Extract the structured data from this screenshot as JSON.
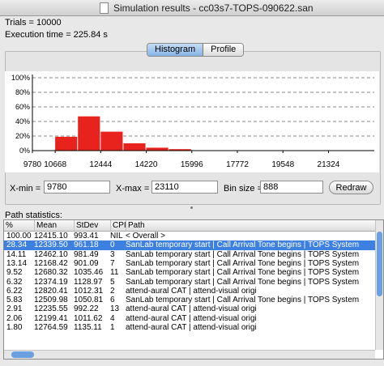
{
  "window": {
    "title": "Simulation results - cc03s7-TOPS-090622.san"
  },
  "summary": {
    "trials": "Trials = 10000",
    "execution_time": "Execution time = 225.84 s"
  },
  "tabs": [
    {
      "label": "Histogram",
      "active": true
    },
    {
      "label": "Profile",
      "active": false
    }
  ],
  "chart_data": {
    "type": "bar",
    "bar_color": "#e8231d",
    "x": [
      9780,
      10668,
      11556,
      12444,
      13332,
      14220,
      15108,
      15996,
      16884,
      17772,
      18660,
      19548,
      20436,
      21324,
      22212
    ],
    "values": [
      0.5,
      19,
      47,
      26,
      10,
      4,
      2,
      0.5,
      0,
      0,
      0,
      0,
      0,
      0,
      0
    ],
    "bin_size": 888,
    "xlim": [
      9780,
      23110
    ],
    "ylim": [
      0,
      100
    ],
    "y_ticks": [
      "0%",
      "20%",
      "40%",
      "60%",
      "80%",
      "100%"
    ],
    "x_ticks": [
      9780,
      10668,
      12444,
      14220,
      15996,
      17772,
      19548,
      21324
    ],
    "grid": true
  },
  "controls": {
    "xmin_label": "X-min =",
    "xmin_value": "9780",
    "xmax_label": "X-max =",
    "xmax_value": "23110",
    "binsize_label": "Bin size =",
    "binsize_value": "888",
    "redraw_label": "Redraw"
  },
  "path_stats": {
    "label": "Path statistics:",
    "columns": [
      "%",
      "Mean",
      "StDev",
      "CPI",
      "Path"
    ],
    "rows": [
      [
        "100.00",
        "12415.10",
        "993.41",
        "NIL",
        "< Overall >"
      ],
      [
        "28.34",
        "12339.50",
        "961.18",
        "0",
        "SanLab temporary start  |  Call Arrival Tone begins  |  TOPS System"
      ],
      [
        "14.11",
        "12462.10",
        "981.49",
        "3",
        "SanLab temporary start  |  Call Arrival Tone begins  |  TOPS System"
      ],
      [
        "13.14",
        "12168.42",
        "901.09",
        "7",
        "SanLab temporary start  |  Call Arrival Tone begins  |  TOPS System"
      ],
      [
        "9.52",
        "12680.32",
        "1035.46",
        "11",
        "SanLab temporary start  |  Call Arrival Tone begins  |  TOPS System"
      ],
      [
        "6.32",
        "12374.19",
        "1128.97",
        "5",
        "SanLab temporary start  |  Call Arrival Tone begins  |  TOPS System"
      ],
      [
        "6.22",
        "12820.41",
        "1012.31",
        "2",
        "attend-aural CAT  |  attend-visual origi"
      ],
      [
        "5.83",
        "12509.98",
        "1050.81",
        "6",
        "SanLab temporary start  |  Call Arrival Tone begins  |  TOPS System"
      ],
      [
        "2.91",
        "12235.55",
        "992.22",
        "13",
        "attend-aural CAT  |  attend-visual origi"
      ],
      [
        "2.06",
        "12199.41",
        "1011.62",
        "4",
        "attend-aural CAT  |  attend-visual origi"
      ],
      [
        "1.80",
        "12764.59",
        "1135.11",
        "1",
        "attend-aural CAT  |  attend-visual origi"
      ]
    ],
    "selected_index": 1
  }
}
